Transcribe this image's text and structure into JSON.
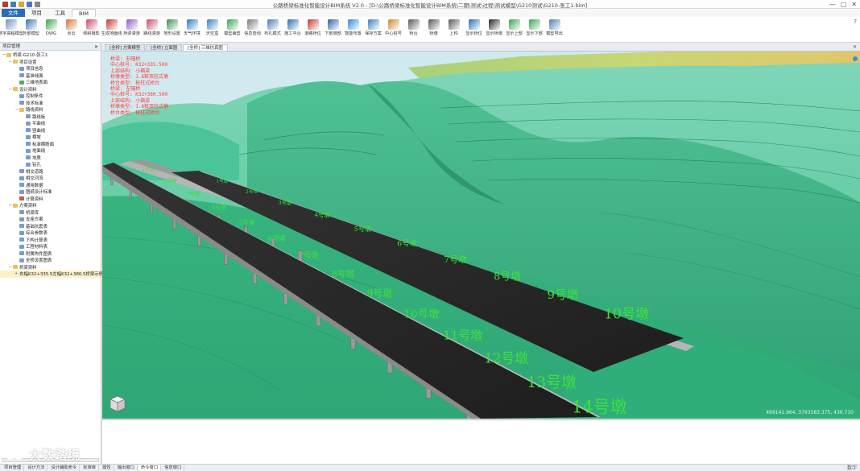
{
  "window": {
    "title": "公路桥梁标准化智能设计BIM系统 V2.0 - [D:\\公路桥梁标准化智能设计BIM系统\\二期\\测试\\过程\\测试模型\\G210测试\\G210-张工1.bim]",
    "minimize": "—",
    "maximize": "▢",
    "close": "✕"
  },
  "menu": {
    "tabs": [
      "文件",
      "项目",
      "工具",
      "BIM"
    ],
    "help": "?"
  },
  "ribbon": {
    "buttons": [
      {
        "label": "数字高程模型",
        "color": "#6d8fc4"
      },
      {
        "label": "外部模型",
        "color": "#3f6fb3"
      },
      {
        "label": "DWG",
        "color": "#3aa34d"
      },
      {
        "label": "点云",
        "color": "#d4743a"
      },
      {
        "label": "倾斜摄影",
        "color": "#c94a6a"
      },
      {
        "label": "生成地面线",
        "color": "#c0392b"
      },
      {
        "label": "桥梁漫游",
        "color": "#8c5cc2"
      },
      {
        "label": "路线漫游",
        "color": "#c94a6a"
      },
      {
        "label": "地形设置",
        "color": "#3a8f4a"
      },
      {
        "label": "天气环境",
        "color": "#2f78c2"
      },
      {
        "label": "天空盒",
        "color": "#3a7fbf"
      },
      {
        "label": "模型裁剪",
        "color": "#3aa34d"
      },
      {
        "label": "信息查询",
        "color": "#7a7a7a"
      },
      {
        "label": "布孔模式",
        "color": "#4a7bb7"
      },
      {
        "label": "施工平台",
        "color": "#2a6db0"
      },
      {
        "label": "道路桥位",
        "color": "#c0392b"
      },
      {
        "label": "下部墩部",
        "color": "#2d5ea8"
      },
      {
        "label": "智能布置",
        "color": "#2a8bd6"
      },
      {
        "label": "保存方案",
        "color": "#3a7fbf"
      },
      {
        "label": "中心桩号",
        "color": "#c98a2a"
      },
      {
        "label": "桥台",
        "color": "#555555"
      },
      {
        "label": "桥墩",
        "color": "#555555"
      },
      {
        "label": "上构",
        "color": "#555555"
      },
      {
        "label": "显示桥位",
        "color": "#2a6db0"
      },
      {
        "label": "显示桥墩",
        "color": "#222222"
      },
      {
        "label": "显示上部",
        "color": "#3aa34d"
      },
      {
        "label": "显示下部",
        "color": "#3aa34d"
      },
      {
        "label": "模型导出",
        "color": "#4a7bb7"
      }
    ]
  },
  "tree": {
    "header": "项目管理",
    "pin": "✕",
    "nodes": [
      {
        "label": "桥梁-G210-张工1",
        "level": 0,
        "icon": "folder",
        "exp": "−"
      },
      {
        "label": "项目设置",
        "level": 1,
        "icon": "folder",
        "exp": "−"
      },
      {
        "label": "项目信息",
        "level": 2,
        "icon": "doc",
        "exp": ""
      },
      {
        "label": "基准线面",
        "level": 2,
        "icon": "doc",
        "exp": ""
      },
      {
        "label": "三维地表面",
        "level": 2,
        "icon": "map",
        "exp": ""
      },
      {
        "label": "设计资料",
        "level": 1,
        "icon": "folder",
        "exp": "−"
      },
      {
        "label": "控制条件",
        "level": 2,
        "icon": "doc",
        "exp": ""
      },
      {
        "label": "技术标准",
        "level": 2,
        "icon": "doc",
        "exp": ""
      },
      {
        "label": "路线资料",
        "level": 2,
        "icon": "folder",
        "exp": "−"
      },
      {
        "label": "路线板",
        "level": 3,
        "icon": "doc",
        "exp": ""
      },
      {
        "label": "平曲线",
        "level": 3,
        "icon": "doc",
        "exp": ""
      },
      {
        "label": "竖曲线",
        "level": 3,
        "icon": "doc",
        "exp": ""
      },
      {
        "label": "横坡",
        "level": 3,
        "icon": "doc",
        "exp": ""
      },
      {
        "label": "标准横断面",
        "level": 3,
        "icon": "doc",
        "exp": ""
      },
      {
        "label": "地面线",
        "level": 3,
        "icon": "doc",
        "exp": ""
      },
      {
        "label": "地质",
        "level": 3,
        "icon": "doc",
        "exp": ""
      },
      {
        "label": "钻孔",
        "level": 3,
        "icon": "doc",
        "exp": ""
      },
      {
        "label": "相交道路",
        "level": 2,
        "icon": "doc",
        "exp": ""
      },
      {
        "label": "相交河流",
        "level": 2,
        "icon": "doc",
        "exp": ""
      },
      {
        "label": "通用数据",
        "level": 2,
        "icon": "doc",
        "exp": ""
      },
      {
        "label": "图纸设计标准",
        "level": 2,
        "icon": "doc",
        "exp": ""
      },
      {
        "label": "计算资料",
        "level": 2,
        "icon": "red",
        "exp": ""
      },
      {
        "label": "方案资料",
        "level": 1,
        "icon": "folder",
        "exp": "−"
      },
      {
        "label": "桥梁库",
        "level": 2,
        "icon": "doc",
        "exp": ""
      },
      {
        "label": "支座方案",
        "level": 2,
        "icon": "doc",
        "exp": ""
      },
      {
        "label": "基础抗震表",
        "level": 2,
        "icon": "doc",
        "exp": ""
      },
      {
        "label": "综合参数表",
        "level": 2,
        "icon": "doc",
        "exp": ""
      },
      {
        "label": "下构计算表",
        "level": 2,
        "icon": "doc",
        "exp": ""
      },
      {
        "label": "工程材料表",
        "level": 2,
        "icon": "doc",
        "exp": ""
      },
      {
        "label": "附属构件图表",
        "level": 2,
        "icon": "doc",
        "exp": ""
      },
      {
        "label": "全桥设置图表",
        "level": 2,
        "icon": "doc",
        "exp": ""
      },
      {
        "label": "桥梁资料",
        "level": 1,
        "icon": "folder",
        "exp": "−"
      },
      {
        "label": "右幅K32+335.5左幅K32+380.5桥梁示例1",
        "level": 2,
        "icon": "folder",
        "exp": "+",
        "sel": true
      }
    ]
  },
  "viewTabs": {
    "tabs": [
      "[全桥] 方案模型",
      "[全桥] 立面图",
      "[全桥] 三维仿真图"
    ],
    "active": 2,
    "close": "✕"
  },
  "scene": {
    "info": [
      "桥梁: 右幅桥",
      "中心桩号: K32+335.500",
      "上部结构: 小箱梁",
      "桥墩类型: 1.6桩双柱式墩",
      "桥台类型: 桩柱式桥台",
      "桥梁: 左幅桥",
      "中心桩号: K32+380.500",
      "上部结构: 小箱梁",
      "桥墩类型: 1.6桩双柱式墩",
      "桥台类型: 桩柱式桥台"
    ],
    "coords": "499141.964, 3793583.375, 430.710",
    "pierLabelColor": "#3ee03e",
    "terrainColor": "#3dbe8a",
    "deckColor": "#2a2a2a"
  },
  "piers": {
    "rightDeck": [
      "1号墩",
      "2号墩",
      "3号墩",
      "4号墩",
      "5号墩",
      "6号墩",
      "7号墩",
      "8号墩",
      "9号墩",
      "10号墩"
    ],
    "leftDeck": [
      "1号墩",
      "2号墩",
      "3号墩",
      "4号墩",
      "5号墩",
      "6号墩",
      "7号墩",
      "8号墩",
      "9号墩",
      "10号墩",
      "11号墩",
      "12号墩",
      "13号墩",
      "14号墩"
    ]
  },
  "bottomTabs": {
    "tabs": [
      "项目管理",
      "设计方法",
      "设计辅助命令",
      "标准库",
      "属性",
      "输出窗口",
      "命令窗口",
      "信息窗口"
    ],
    "active": 6,
    "statusRight": "数字"
  },
  "watermark": {
    "text": "大数踏境"
  }
}
